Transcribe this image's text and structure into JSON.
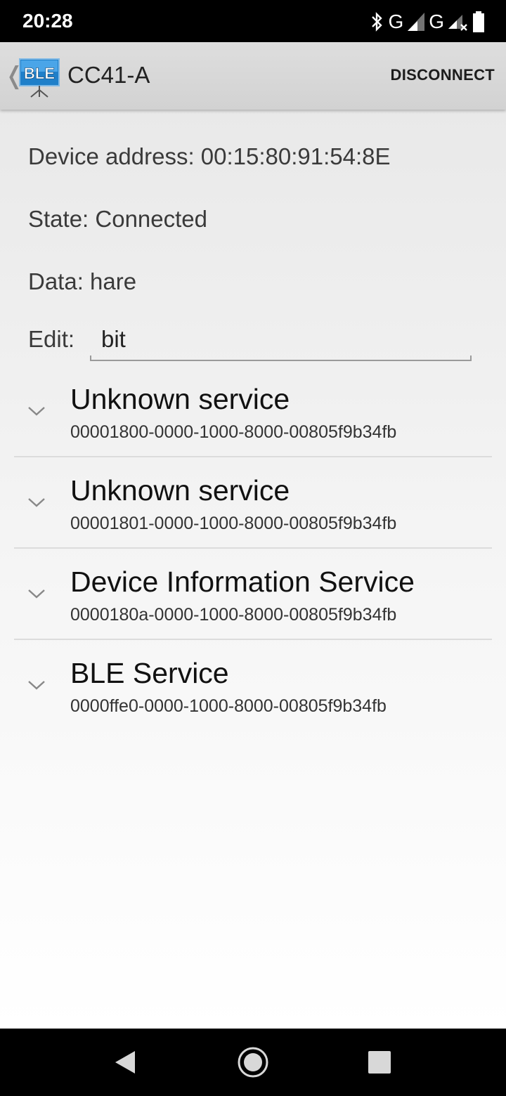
{
  "status_bar": {
    "time": "20:28",
    "network1": "G",
    "network2": "G",
    "icons": [
      "bluetooth-icon",
      "signal-icon",
      "signal-no-service-icon",
      "battery-icon"
    ]
  },
  "action_bar": {
    "logo_text": "BLE",
    "title": "CC41-A",
    "disconnect_label": "DISCONNECT"
  },
  "device": {
    "address_line": "Device address: 00:15:80:91:54:8E",
    "state_line": "State: Connected",
    "data_line": "Data: hare",
    "edit_label": "Edit:",
    "edit_value": "bit"
  },
  "services": [
    {
      "name": "Unknown service",
      "uuid": "00001800-0000-1000-8000-00805f9b34fb"
    },
    {
      "name": "Unknown service",
      "uuid": "00001801-0000-1000-8000-00805f9b34fb"
    },
    {
      "name": "Device Information Service",
      "uuid": "0000180a-0000-1000-8000-00805f9b34fb"
    },
    {
      "name": "BLE Service",
      "uuid": "0000ffe0-0000-1000-8000-00805f9b34fb"
    }
  ],
  "colors": {
    "action_bar_bg": "#d6d6d6",
    "logo_blue": "#2d8fd6",
    "nav_bg": "#000000"
  }
}
